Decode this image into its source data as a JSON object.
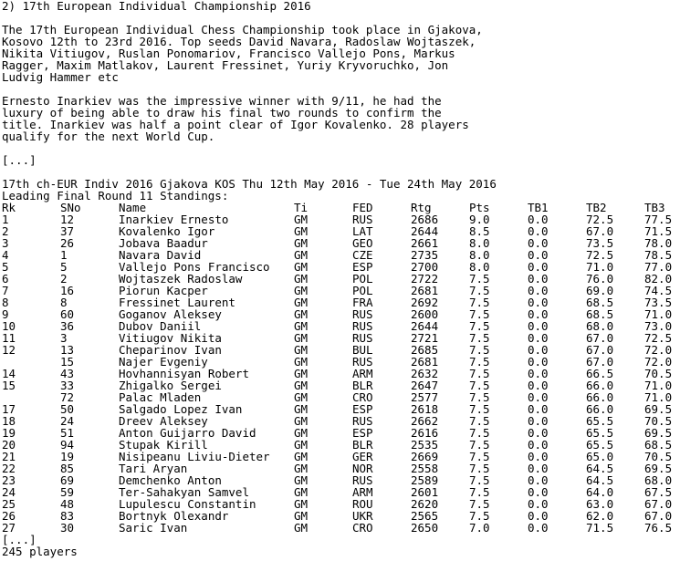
{
  "heading": "2) 17th European Individual Championship 2016",
  "paragraph1": [
    "The 17th European Individual Chess Championship took place in Gjakova,",
    "Kosovo 12th to 23rd 2016. Top seeds David Navara, Radoslaw Wojtaszek,",
    "Nikita Vitiugov, Ruslan Ponomariov, Francisco Vallejo Pons, Markus",
    "Ragger, Maxim Matlakov, Laurent Fressinet, Yuriy Kryvoruchko, Jon",
    "Ludvig Hammer etc"
  ],
  "paragraph2": [
    "Ernesto Inarkiev was the impressive winner with 9/11, he had the",
    "luxury of being able to draw his final two rounds to confirm the",
    "title. Inarkiev was half a point clear of Igor Kovalenko. 28 players",
    "qualify for the next World Cup."
  ],
  "ellipsis_top": "[...]",
  "event_line": "17th ch-EUR Indiv 2016 Gjakova KOS Thu 12th May 2016 - Tue 24th May 2016",
  "standings_title": "Leading Final Round 11 Standings:",
  "columns": {
    "rk": "Rk",
    "sno": "SNo",
    "name": "Name",
    "ti": "Ti",
    "fed": "FED",
    "rtg": "Rtg",
    "pts": "Pts",
    "tb1": "TB1",
    "tb2": "TB2",
    "tb3": "TB3"
  },
  "rows": [
    {
      "rk": "1",
      "sno": "12",
      "name": "Inarkiev Ernesto",
      "ti": "GM",
      "fed": "RUS",
      "rtg": "2686",
      "pts": "9.0",
      "tb1": "0.0",
      "tb2": "72.5",
      "tb3": "77.5"
    },
    {
      "rk": "2",
      "sno": "37",
      "name": "Kovalenko Igor",
      "ti": "GM",
      "fed": "LAT",
      "rtg": "2644",
      "pts": "8.5",
      "tb1": "0.0",
      "tb2": "67.0",
      "tb3": "71.5"
    },
    {
      "rk": "3",
      "sno": "26",
      "name": "Jobava Baadur",
      "ti": "GM",
      "fed": "GEO",
      "rtg": "2661",
      "pts": "8.0",
      "tb1": "0.0",
      "tb2": "73.5",
      "tb3": "78.0"
    },
    {
      "rk": "4",
      "sno": "1",
      "name": "Navara David",
      "ti": "GM",
      "fed": "CZE",
      "rtg": "2735",
      "pts": "8.0",
      "tb1": "0.0",
      "tb2": "72.5",
      "tb3": "78.5"
    },
    {
      "rk": "5",
      "sno": "5",
      "name": "Vallejo Pons Francisco",
      "ti": "GM",
      "fed": "ESP",
      "rtg": "2700",
      "pts": "8.0",
      "tb1": "0.0",
      "tb2": "71.0",
      "tb3": "77.0"
    },
    {
      "rk": "6",
      "sno": "2",
      "name": "Wojtaszek Radoslaw",
      "ti": "GM",
      "fed": "POL",
      "rtg": "2722",
      "pts": "7.5",
      "tb1": "0.0",
      "tb2": "76.0",
      "tb3": "82.0"
    },
    {
      "rk": "7",
      "sno": "16",
      "name": "Piorun Kacper",
      "ti": "GM",
      "fed": "POL",
      "rtg": "2681",
      "pts": "7.5",
      "tb1": "0.0",
      "tb2": "69.0",
      "tb3": "74.5"
    },
    {
      "rk": "8",
      "sno": "8",
      "name": "Fressinet Laurent",
      "ti": "GM",
      "fed": "FRA",
      "rtg": "2692",
      "pts": "7.5",
      "tb1": "0.0",
      "tb2": "68.5",
      "tb3": "73.5"
    },
    {
      "rk": "9",
      "sno": "60",
      "name": "Goganov Aleksey",
      "ti": "GM",
      "fed": "RUS",
      "rtg": "2600",
      "pts": "7.5",
      "tb1": "0.0",
      "tb2": "68.5",
      "tb3": "71.0"
    },
    {
      "rk": "10",
      "sno": "36",
      "name": "Dubov Daniil",
      "ti": "GM",
      "fed": "RUS",
      "rtg": "2644",
      "pts": "7.5",
      "tb1": "0.0",
      "tb2": "68.0",
      "tb3": "73.0"
    },
    {
      "rk": "11",
      "sno": "3",
      "name": "Vitiugov Nikita",
      "ti": "GM",
      "fed": "RUS",
      "rtg": "2721",
      "pts": "7.5",
      "tb1": "0.0",
      "tb2": "67.0",
      "tb3": "72.5"
    },
    {
      "rk": "12",
      "sno": "13",
      "name": "Cheparinov Ivan",
      "ti": "GM",
      "fed": "BUL",
      "rtg": "2685",
      "pts": "7.5",
      "tb1": "0.0",
      "tb2": "67.0",
      "tb3": "72.0"
    },
    {
      "rk": "",
      "sno": "15",
      "name": "Najer Evgeniy",
      "ti": "GM",
      "fed": "RUS",
      "rtg": "2681",
      "pts": "7.5",
      "tb1": "0.0",
      "tb2": "67.0",
      "tb3": "72.0"
    },
    {
      "rk": "14",
      "sno": "43",
      "name": "Hovhannisyan Robert",
      "ti": "GM",
      "fed": "ARM",
      "rtg": "2632",
      "pts": "7.5",
      "tb1": "0.0",
      "tb2": "66.5",
      "tb3": "70.5"
    },
    {
      "rk": "15",
      "sno": "33",
      "name": "Zhigalko Sergei",
      "ti": "GM",
      "fed": "BLR",
      "rtg": "2647",
      "pts": "7.5",
      "tb1": "0.0",
      "tb2": "66.0",
      "tb3": "71.0"
    },
    {
      "rk": "",
      "sno": "72",
      "name": "Palac Mladen",
      "ti": "GM",
      "fed": "CRO",
      "rtg": "2577",
      "pts": "7.5",
      "tb1": "0.0",
      "tb2": "66.0",
      "tb3": "71.0"
    },
    {
      "rk": "17",
      "sno": "50",
      "name": "Salgado Lopez Ivan",
      "ti": "GM",
      "fed": "ESP",
      "rtg": "2618",
      "pts": "7.5",
      "tb1": "0.0",
      "tb2": "66.0",
      "tb3": "69.5"
    },
    {
      "rk": "18",
      "sno": "24",
      "name": "Dreev Aleksey",
      "ti": "GM",
      "fed": "RUS",
      "rtg": "2662",
      "pts": "7.5",
      "tb1": "0.0",
      "tb2": "65.5",
      "tb3": "70.5"
    },
    {
      "rk": "19",
      "sno": "51",
      "name": "Anton Guijarro David",
      "ti": "GM",
      "fed": "ESP",
      "rtg": "2616",
      "pts": "7.5",
      "tb1": "0.0",
      "tb2": "65.5",
      "tb3": "69.5"
    },
    {
      "rk": "20",
      "sno": "94",
      "name": "Stupak Kirill",
      "ti": "GM",
      "fed": "BLR",
      "rtg": "2535",
      "pts": "7.5",
      "tb1": "0.0",
      "tb2": "65.5",
      "tb3": "68.5"
    },
    {
      "rk": "21",
      "sno": "19",
      "name": "Nisipeanu Liviu-Dieter",
      "ti": "GM",
      "fed": "GER",
      "rtg": "2669",
      "pts": "7.5",
      "tb1": "0.0",
      "tb2": "65.0",
      "tb3": "70.5"
    },
    {
      "rk": "22",
      "sno": "85",
      "name": "Tari Aryan",
      "ti": "GM",
      "fed": "NOR",
      "rtg": "2558",
      "pts": "7.5",
      "tb1": "0.0",
      "tb2": "64.5",
      "tb3": "69.5"
    },
    {
      "rk": "23",
      "sno": "69",
      "name": "Demchenko Anton",
      "ti": "GM",
      "fed": "RUS",
      "rtg": "2589",
      "pts": "7.5",
      "tb1": "0.0",
      "tb2": "64.5",
      "tb3": "68.0"
    },
    {
      "rk": "24",
      "sno": "59",
      "name": "Ter-Sahakyan Samvel",
      "ti": "GM",
      "fed": "ARM",
      "rtg": "2601",
      "pts": "7.5",
      "tb1": "0.0",
      "tb2": "64.0",
      "tb3": "67.5"
    },
    {
      "rk": "25",
      "sno": "48",
      "name": "Lupulescu Constantin",
      "ti": "GM",
      "fed": "ROU",
      "rtg": "2620",
      "pts": "7.5",
      "tb1": "0.0",
      "tb2": "63.0",
      "tb3": "67.0"
    },
    {
      "rk": "26",
      "sno": "83",
      "name": "Bortnyk Olexandr",
      "ti": "GM",
      "fed": "UKR",
      "rtg": "2565",
      "pts": "7.5",
      "tb1": "0.0",
      "tb2": "62.0",
      "tb3": "67.0"
    },
    {
      "rk": "27",
      "sno": "30",
      "name": "Saric Ivan",
      "ti": "GM",
      "fed": "CRO",
      "rtg": "2650",
      "pts": "7.0",
      "tb1": "0.0",
      "tb2": "71.5",
      "tb3": "76.5"
    }
  ],
  "ellipsis_bottom": "[...]",
  "players_count": "245 players"
}
